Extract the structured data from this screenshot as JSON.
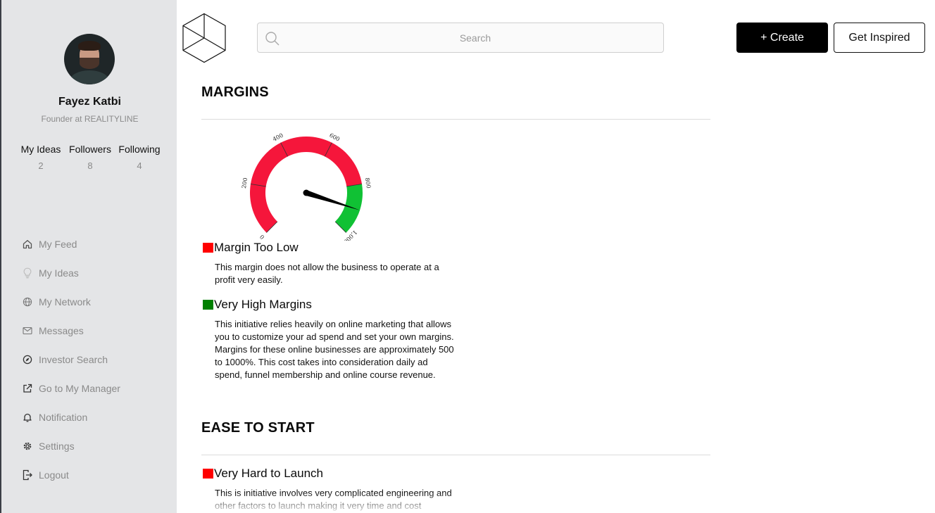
{
  "profile": {
    "name": "Fayez Katbi",
    "title": "Founder at REALITYLINE",
    "stats": [
      {
        "label": "My Ideas",
        "value": "2"
      },
      {
        "label": "Followers",
        "value": "8"
      },
      {
        "label": "Following",
        "value": "4"
      }
    ]
  },
  "nav": {
    "items": [
      {
        "label": "My Feed",
        "icon": "home-icon"
      },
      {
        "label": "My Ideas",
        "icon": "lightbulb-icon"
      },
      {
        "label": "My Network",
        "icon": "globe-icon"
      },
      {
        "label": "Messages",
        "icon": "envelope-icon"
      },
      {
        "label": "Investor Search",
        "icon": "compass-icon"
      },
      {
        "label": "Go to My Manager",
        "icon": "external-link-icon"
      },
      {
        "label": "Notification",
        "icon": "bell-icon"
      },
      {
        "label": "Settings",
        "icon": "gear-icon"
      },
      {
        "label": "Logout",
        "icon": "logout-icon"
      }
    ]
  },
  "header": {
    "search_placeholder": "Search",
    "create_label": "+ Create",
    "inspire_label": "Get Inspired"
  },
  "sections": {
    "margins": {
      "title": "MARGINS",
      "gauge": {
        "min": 0,
        "max": 1000,
        "ticks": [
          "0",
          "200",
          "400",
          "600",
          "800",
          "1,000"
        ],
        "value": 900,
        "red_range": [
          0,
          800
        ],
        "green_range": [
          800,
          1000
        ],
        "colors": {
          "red": "#f5163b",
          "green": "#10c134",
          "needle": "#000000"
        }
      },
      "items": [
        {
          "label": "Margin Too Low",
          "color": "#ff0000",
          "desc": "This margin does not allow the business to operate at a profit very easily."
        },
        {
          "label": "Very High Margins",
          "color": "#008000",
          "desc": "This initiative relies heavily on online marketing that allows you to customize your ad spend and set your own margins. Margins for these online businesses are approximately 500 to 1000%. This cost takes into consideration daily ad spend, funnel membership and online course revenue."
        }
      ]
    },
    "ease": {
      "title": "EASE TO START",
      "items": [
        {
          "label": "Very Hard to Launch",
          "color": "#ff0000",
          "desc": "This is initiative involves very complicated engineering and other factors to launch making it very time and cost"
        }
      ]
    }
  }
}
